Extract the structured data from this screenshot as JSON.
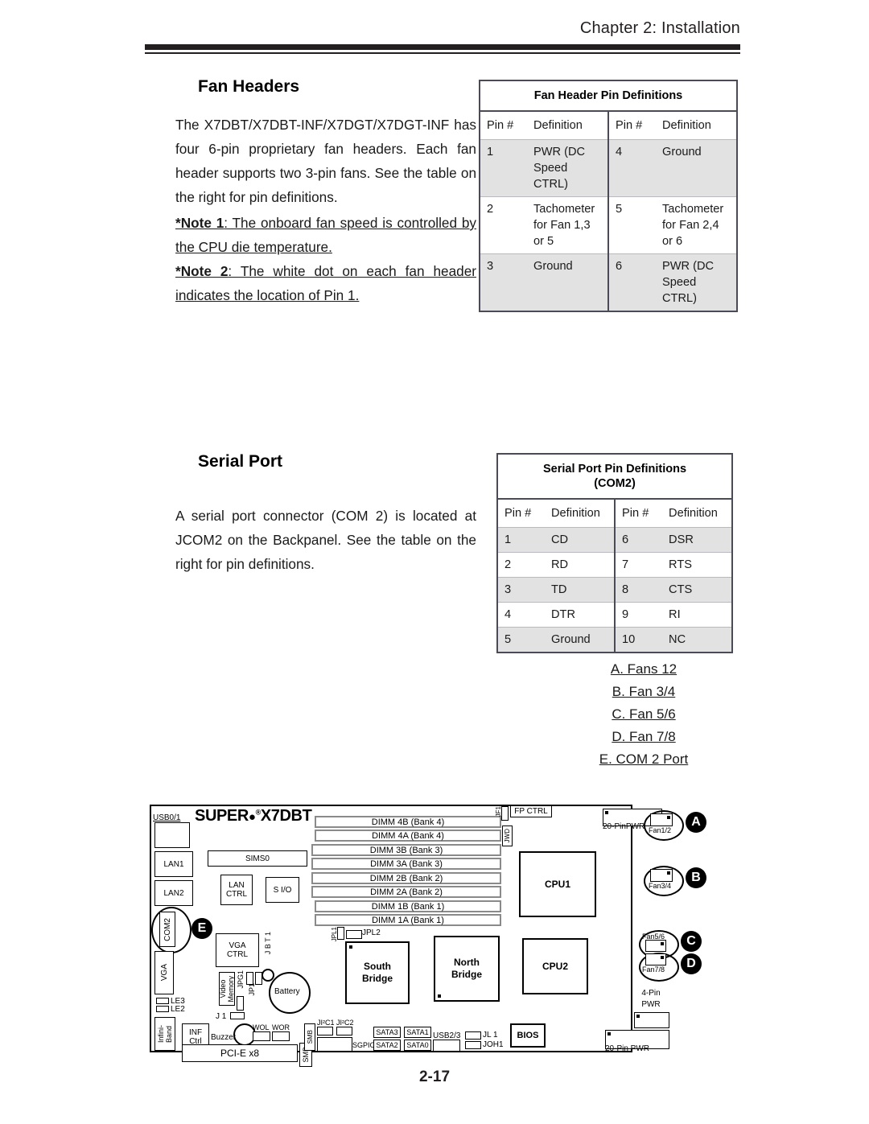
{
  "header": {
    "chapter": "Chapter 2: Installation"
  },
  "fan_section": {
    "heading": "Fan Headers",
    "paragraph": "The X7DBT/X7DBT-INF/X7DGT/X7DGT-INF has four 6-pin proprietary fan headers. Each fan header supports two 3-pin fans. See the table on the right for pin definitions.",
    "note1_label": "*Note 1",
    "note1_text": ": The onboard fan speed is controlled by the CPU die temperature.",
    "note2_label": "*Note 2",
    "note2_text": ": The white dot on each fan header indicates the location of Pin 1."
  },
  "fan_table": {
    "caption": "Fan Header Pin Definitions",
    "columns": [
      "Pin #",
      "Definition",
      "Pin #",
      "Definition"
    ],
    "rows": [
      {
        "pin_a": "1",
        "def_a": "PWR (DC Speed CTRL)",
        "pin_b": "4",
        "def_b": "Ground",
        "shaded": true
      },
      {
        "pin_a": "2",
        "def_a": "Tachometer for Fan 1,3 or 5",
        "pin_b": "5",
        "def_b": "Tachometer for Fan 2,4 or 6",
        "shaded": false
      },
      {
        "pin_a": "3",
        "def_a": "Ground",
        "pin_b": "6",
        "def_b": "PWR (DC Speed CTRL)",
        "shaded": true
      }
    ]
  },
  "serial_section": {
    "heading": "Serial Port",
    "paragraph": "A serial port connector (COM 2) is located at JCOM2 on the Backpanel. See the table on the right for pin definitions."
  },
  "serial_table": {
    "caption_line1": "Serial Port Pin Definitions",
    "caption_line2": "(COM2)",
    "columns": [
      "Pin #",
      "Definition",
      "Pin #",
      "Definition"
    ],
    "rows": [
      {
        "pin_a": "1",
        "def_a": "CD",
        "pin_b": "6",
        "def_b": "DSR",
        "shaded": true
      },
      {
        "pin_a": "2",
        "def_a": "RD",
        "pin_b": "7",
        "def_b": "RTS",
        "shaded": false
      },
      {
        "pin_a": "3",
        "def_a": "TD",
        "pin_b": "8",
        "def_b": "CTS",
        "shaded": true
      },
      {
        "pin_a": "4",
        "def_a": "DTR",
        "pin_b": "9",
        "def_b": "RI",
        "shaded": false
      },
      {
        "pin_a": "5",
        "def_a": "Ground",
        "pin_b": "10",
        "def_b": "NC",
        "shaded": true
      }
    ]
  },
  "legend": {
    "items": [
      "A. Fans 12",
      "B. Fan 3/4",
      "C. Fan 5/6",
      "D. Fan 7/8",
      "E. COM 2 Port"
    ]
  },
  "diagram": {
    "logo_super": "SUPER",
    "logo_reg": "®",
    "logo_model": "X7DBT",
    "markers": [
      "A",
      "B",
      "C",
      "D",
      "E"
    ],
    "backpanel": {
      "usb": "USB0/1",
      "lan1": "LAN1",
      "lan2": "LAN2",
      "com2": "COM2",
      "vga": "VGA",
      "infiniband": "Infini-\nBand"
    },
    "components": {
      "sims0": "SIMS0",
      "lan_ctrl": "LAN\nCTRL",
      "sio": "S I/O",
      "vga_ctrl": "VGA\nCTRL",
      "video_memory": "Video\nMemory",
      "battery": "Battery",
      "buzzer": "Buzzer",
      "inf_ctrl": "INF\nCtrl",
      "pcie": "PCI-E  x8",
      "south_bridge": "South\nBridge",
      "north_bridge": "North\nBridge",
      "cpu1": "CPU1",
      "cpu2": "CPU2",
      "bios": "BIOS"
    },
    "dimms": [
      "DIMM 4B (Bank 4)",
      "DIMM 4A (Bank 4)",
      "DIMM 3B (Bank 3)",
      "DIMM 3A (Bank 3)",
      "DIMM 2B (Bank 2)",
      "DIMM 2A (Bank 2)",
      "DIMM 1B (Bank 1)",
      "DIMM 1A (Bank 1)"
    ],
    "fans": {
      "fan12": "Fan1/2",
      "fan34": "Fan3/4",
      "fan56": "Fan5/6",
      "fan78": "Fan7/8"
    },
    "power": {
      "pwr20_top": "20-PinPWR",
      "pwr4": "4-Pin\nPWR",
      "pwr20_bottom": "20-Pin  PWR"
    },
    "headers": {
      "fp_ctrl": "FP CTRL",
      "jf1": "JF1",
      "jwd": "JWD",
      "jpl1": "JPL1",
      "jpl2": "JPL2",
      "jpg1": "JPG1",
      "jp1": "JP1",
      "jbt1": "J B T 1",
      "j1": "J 1",
      "le3": "LE3",
      "le2": "LE2",
      "wol": "WOL",
      "wor": "WOR",
      "smb_left": "SMB",
      "smb_bottom": "SMB",
      "ji2c1": "JI²C1",
      "ji2c2": "JI²C2",
      "sgpio": "SGPIO",
      "sata0": "SATA0",
      "sata1": "SATA1",
      "sata2": "SATA2",
      "sata3": "SATA3",
      "usb23": "USB2/3",
      "jl1": "JL 1",
      "joh1": "JOH1"
    }
  },
  "footer": {
    "page_number": "2-17"
  }
}
